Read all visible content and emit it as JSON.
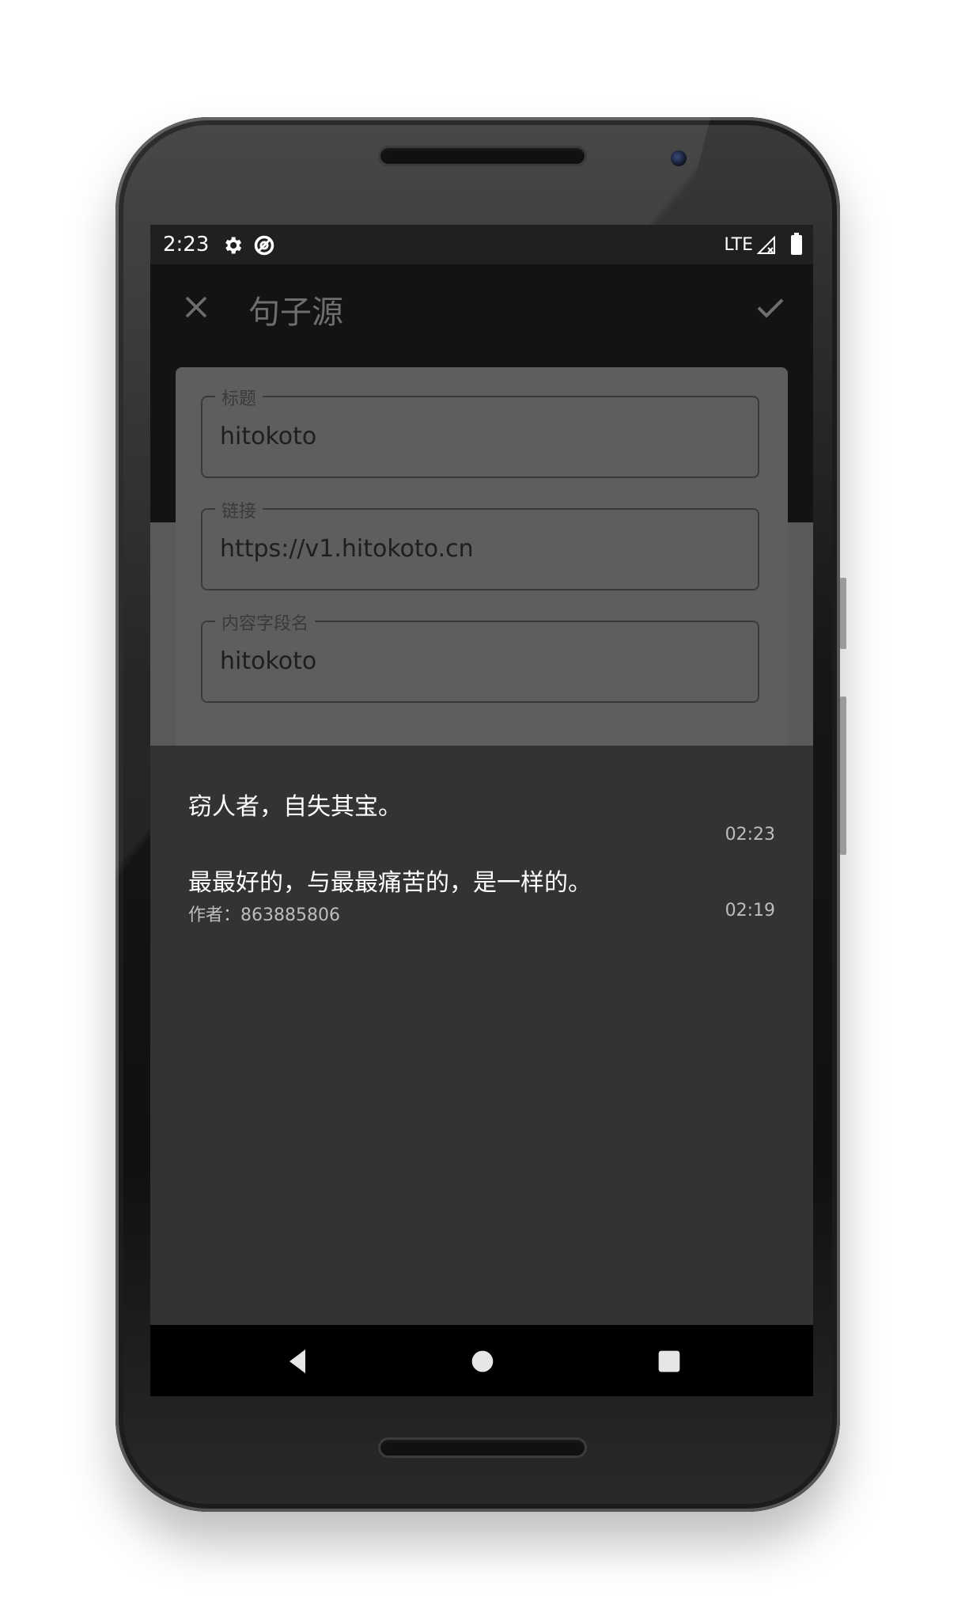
{
  "status": {
    "time": "2:23",
    "network": "LTE",
    "icons": [
      "settings-icon",
      "sync-icon",
      "signal-icon",
      "battery-icon"
    ]
  },
  "appbar": {
    "title": "句子源",
    "close_icon": "close-icon",
    "confirm_icon": "check-icon"
  },
  "form": {
    "fields": [
      {
        "label": "标题",
        "value": "hitokoto"
      },
      {
        "label": "链接",
        "value": "https://v1.hitokoto.cn"
      },
      {
        "label": "内容字段名",
        "value": "hitokoto"
      }
    ]
  },
  "messages": [
    {
      "text": "窃人者，自失其宝。",
      "author": "",
      "time": "02:23"
    },
    {
      "text": "最最好的，与最最痛苦的，是一样的。",
      "author": "作者：863885806",
      "time": "02:19"
    }
  ],
  "nav": {
    "icons": [
      "back-icon",
      "home-icon",
      "recents-icon"
    ]
  },
  "colors": {
    "status_bar": "#202020",
    "app_bar": "#131313",
    "card": "#5e5e5e",
    "sheet": "#333333"
  }
}
